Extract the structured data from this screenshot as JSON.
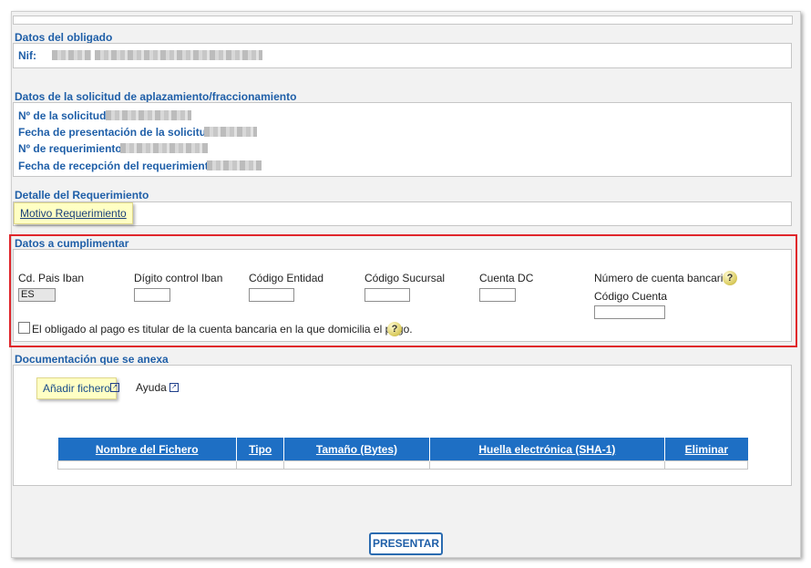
{
  "obligado": {
    "title": "Datos del obligado",
    "nif_label": "Nif:"
  },
  "solicitud": {
    "title": "Datos de la solicitud de aplazamiento/fraccionamiento",
    "num_solicitud_label": "Nº de la solicitud:",
    "fecha_presentacion_label": "Fecha de presentación de la solicitud:",
    "num_requerimiento_label": "Nº de requerimiento:",
    "fecha_recepcion_label": "Fecha de recepción del requerimiento:"
  },
  "detalle": {
    "title": "Detalle del Requerimiento",
    "motivo_link": "Motivo Requerimiento"
  },
  "cumplimentar": {
    "title": "Datos a cumplimentar",
    "pais_iban_label": "Cd. Pais Iban",
    "pais_iban_value": "ES",
    "digito_iban_label": "Dígito control Iban",
    "codigo_entidad_label": "Código Entidad",
    "codigo_sucursal_label": "Código Sucursal",
    "cuenta_dc_label": "Cuenta DC",
    "numero_cuenta_label": "Número de cuenta bancaria",
    "codigo_cuenta_label": "Código Cuenta",
    "titular_checkbox_label": "El obligado al pago es titular de la cuenta bancaria en la que domicilia el pago.",
    "help_glyph": "?"
  },
  "documentacion": {
    "title": "Documentación que se anexa",
    "add_file_label": "Añadir fichero",
    "ayuda_label": "Ayuda",
    "columns": [
      "Nombre del Fichero",
      "Tipo",
      "Tamaño (Bytes)",
      "Huella electrónica (SHA-1)",
      "Eliminar"
    ]
  },
  "footer": {
    "submit_label": "PRESENTAR"
  }
}
